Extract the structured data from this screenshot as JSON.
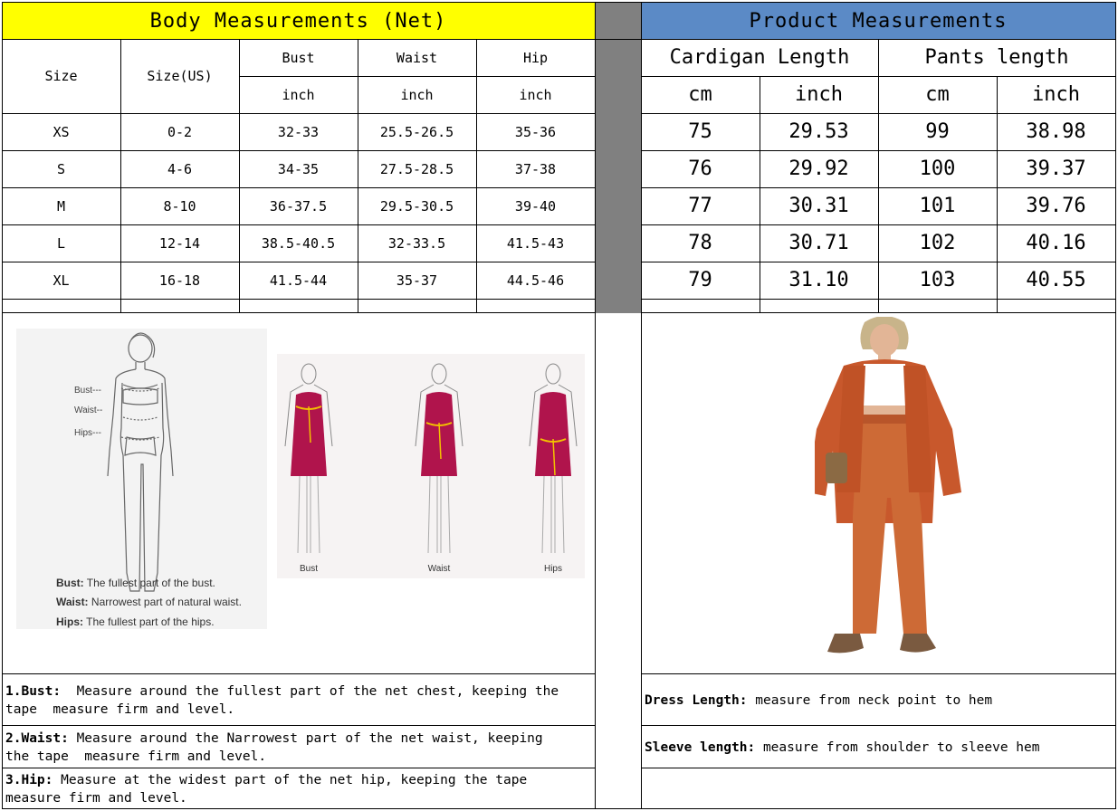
{
  "left": {
    "title": "Body Measurements (Net)",
    "size_header": "Size",
    "size_us_header": "Size(US)",
    "cols": [
      {
        "name": "Bust",
        "unit": "inch"
      },
      {
        "name": "Waist",
        "unit": "inch"
      },
      {
        "name": "Hip",
        "unit": "inch"
      }
    ],
    "rows": [
      [
        "XS",
        "0-2",
        "32-33",
        "25.5-26.5",
        "35-36"
      ],
      [
        "S",
        "4-6",
        "34-35",
        "27.5-28.5",
        "37-38"
      ],
      [
        "M",
        "8-10",
        "36-37.5",
        "29.5-30.5",
        "39-40"
      ],
      [
        "L",
        "12-14",
        "38.5-40.5",
        "32-33.5",
        "41.5-43"
      ],
      [
        "XL",
        "16-18",
        "41.5-44",
        "35-37",
        "44.5-46"
      ]
    ],
    "diagram": {
      "bust_tag": "Bust---",
      "waist_tag": "Waist--",
      "hips_tag": "Hips---",
      "legend": [
        {
          "term": "Bust:",
          "desc": "The fullest part of the bust."
        },
        {
          "term": "Waist:",
          "desc": "Narrowest part of natural waist."
        },
        {
          "term": "Hips:",
          "desc": "The fullest part of the hips."
        }
      ],
      "figure_labels": [
        "Bust",
        "Waist",
        "Hips"
      ]
    },
    "notes": [
      {
        "term": "1.Bust:",
        "line1": "  Measure around the fullest part of the net chest, keeping the",
        "line2": "tape  measure firm and level."
      },
      {
        "term": "2.Waist:",
        "line1": " Measure around the Narrowest part of the net waist, keeping",
        "line2": "the tape  measure firm and level."
      },
      {
        "term": "3.Hip:",
        "line1": " Measure at the widest part of the net hip, keeping the tape",
        "line2": "measure firm and level."
      }
    ]
  },
  "right": {
    "title": "Product Measurements",
    "groups": [
      "Cardigan Length",
      "Pants length"
    ],
    "units": [
      "cm",
      "inch",
      "cm",
      "inch"
    ],
    "rows": [
      [
        "75",
        "29.53",
        "99",
        "38.98"
      ],
      [
        "76",
        "29.92",
        "100",
        "39.37"
      ],
      [
        "77",
        "30.31",
        "101",
        "39.76"
      ],
      [
        "78",
        "30.71",
        "102",
        "40.16"
      ],
      [
        "79",
        "31.10",
        "103",
        "40.55"
      ]
    ],
    "notes": [
      {
        "term": "Dress Length:",
        "desc": " measure from neck point to hem"
      },
      {
        "term": "Sleeve length:",
        "desc": " measure from shoulder to sleeve hem"
      }
    ]
  },
  "colors": {
    "left_header": "#ffff00",
    "right_header": "#5b8ac6",
    "separator": "#808080",
    "dress": "#b0144c",
    "outfit": "#c8582c"
  }
}
